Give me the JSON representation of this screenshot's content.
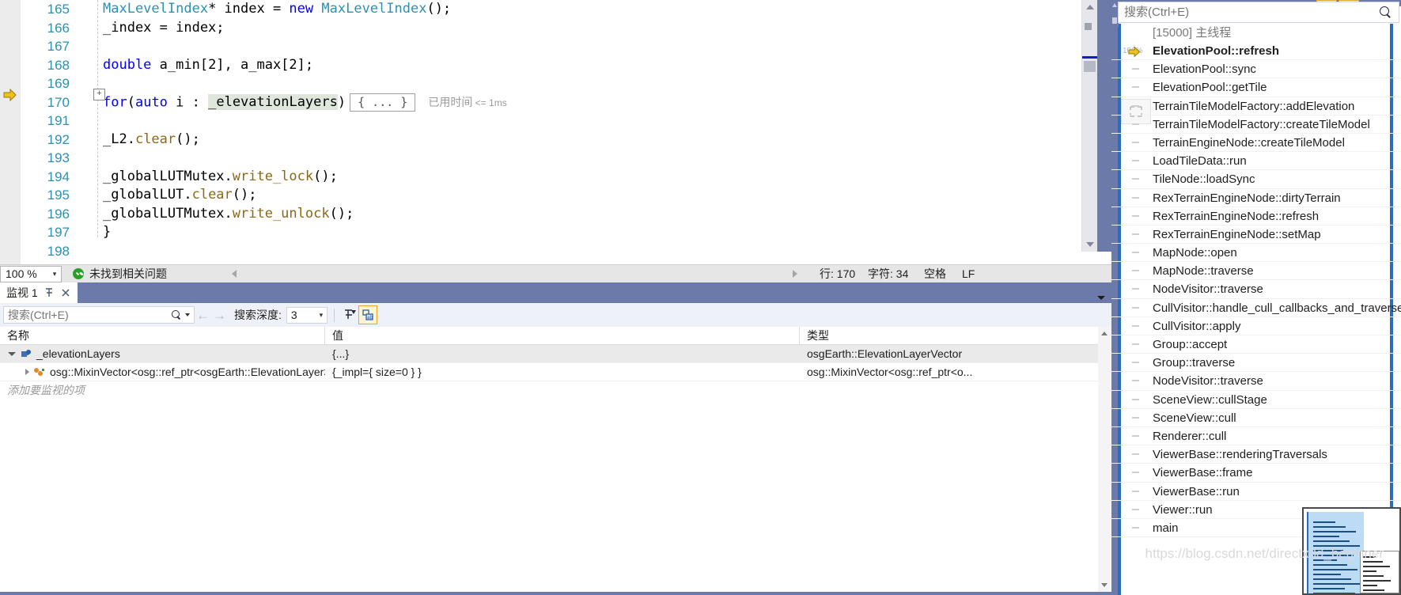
{
  "editor": {
    "lines": [
      {
        "num": "165",
        "segments": [
          {
            "t": "MaxLevelIndex",
            "c": "ty"
          },
          {
            "t": "* index = ",
            "c": "pl"
          },
          {
            "t": "new",
            "c": "kw"
          },
          {
            "t": " ",
            "c": "pl"
          },
          {
            "t": "MaxLevelIndex",
            "c": "ty"
          },
          {
            "t": "();",
            "c": "pl"
          }
        ]
      },
      {
        "num": "166",
        "segments": [
          {
            "t": "_index = index;",
            "c": "pl"
          }
        ]
      },
      {
        "num": "167",
        "segments": []
      },
      {
        "num": "168",
        "segments": [
          {
            "t": "double",
            "c": "kw"
          },
          {
            "t": " a_min[2], a_max[2];",
            "c": "pl"
          }
        ]
      },
      {
        "num": "169",
        "segments": []
      },
      {
        "num": "170",
        "segments": [
          {
            "t": "for",
            "c": "kw"
          },
          {
            "t": "(",
            "c": "pl"
          },
          {
            "t": "auto",
            "c": "kw"
          },
          {
            "t": " i : ",
            "c": "pl"
          },
          {
            "t": "_elevationLayers",
            "c": "hl-ident"
          },
          {
            "t": ")",
            "c": "pl"
          }
        ]
      },
      {
        "num": "191",
        "segments": []
      },
      {
        "num": "192",
        "segments": [
          {
            "t": "_L2.",
            "c": "pl"
          },
          {
            "t": "clear",
            "c": "fn"
          },
          {
            "t": "();",
            "c": "pl"
          }
        ]
      },
      {
        "num": "193",
        "segments": []
      },
      {
        "num": "194",
        "segments": [
          {
            "t": "_globalLUTMutex.",
            "c": "pl"
          },
          {
            "t": "write_lock",
            "c": "fn"
          },
          {
            "t": "();",
            "c": "pl"
          }
        ]
      },
      {
        "num": "195",
        "segments": [
          {
            "t": "_globalLUT.",
            "c": "pl"
          },
          {
            "t": "clear",
            "c": "fn"
          },
          {
            "t": "();",
            "c": "pl"
          }
        ]
      },
      {
        "num": "196",
        "segments": [
          {
            "t": "_globalLUTMutex.",
            "c": "pl"
          },
          {
            "t": "write_unlock",
            "c": "fn"
          },
          {
            "t": "();",
            "c": "pl"
          }
        ]
      },
      {
        "num": "197",
        "segments": [
          {
            "t": "}",
            "c": "pl"
          }
        ]
      },
      {
        "num": "198",
        "segments": []
      }
    ],
    "collapsed_block_label": "{ ... }",
    "elapsed_label": "已用时间",
    "elapsed_value": "<= 1ms",
    "outline_toggle": "+"
  },
  "editor_status": {
    "zoom_value": "100 %",
    "zoom_caret": "▾",
    "problems_text": "未找到相关问题",
    "line_label": "行: 170",
    "char_label": "字符: 34",
    "space_label": "空格",
    "eol_label": "LF"
  },
  "watch": {
    "tab_title": "监视 1",
    "pin_icon": "pin-icon",
    "close_icon": "close-icon",
    "search_placeholder": "搜索(Ctrl+E)",
    "search_value": "",
    "depth_label": "搜索深度:",
    "depth_value": "3",
    "back_arrow": "←",
    "forward_arrow": "→",
    "filter_icon": "filter-pin-icon",
    "hex_icon": "hex-display-icon",
    "columns": [
      "名称",
      "值",
      "类型"
    ],
    "rows": [
      {
        "name": "_elevationLayers",
        "value": "{...}",
        "type": "osgEarth::ElevationLayerVector",
        "depth": 0,
        "expanded": true,
        "selected": true,
        "icon": "field-icon"
      },
      {
        "name": "osg::MixinVector<osg::ref_ptr<osgEarth::ElevationLayer> ...",
        "value": "{_impl={ size=0 } }",
        "type": "osg::MixinVector<osg::ref_ptr<o...",
        "depth": 1,
        "expanded": false,
        "selected": false,
        "icon": "base-class-icon"
      }
    ],
    "add_watch_placeholder": "添加要监视的项"
  },
  "callstack": {
    "search_placeholder": "搜索(Ctrl+E)",
    "partial_top_text": "[15000] 主线程",
    "zoom_hint": "100%",
    "frames": [
      {
        "label": "ElevationPool::refresh",
        "current": true
      },
      {
        "label": "ElevationPool::sync",
        "current": false
      },
      {
        "label": "ElevationPool::getTile",
        "current": false
      },
      {
        "label": "TerrainTileModelFactory::addElevation",
        "current": false
      },
      {
        "label": "TerrainTileModelFactory::createTileModel",
        "current": false
      },
      {
        "label": "TerrainEngineNode::createTileModel",
        "current": false
      },
      {
        "label": "LoadTileData::run",
        "current": false
      },
      {
        "label": "TileNode::loadSync",
        "current": false
      },
      {
        "label": "RexTerrainEngineNode::dirtyTerrain",
        "current": false
      },
      {
        "label": "RexTerrainEngineNode::refresh",
        "current": false
      },
      {
        "label": "RexTerrainEngineNode::setMap",
        "current": false
      },
      {
        "label": "MapNode::open",
        "current": false
      },
      {
        "label": "MapNode::traverse",
        "current": false
      },
      {
        "label": "NodeVisitor::traverse",
        "current": false
      },
      {
        "label": "CullVisitor::handle_cull_callbacks_and_traverse",
        "current": false
      },
      {
        "label": "CullVisitor::apply",
        "current": false
      },
      {
        "label": "Group::accept",
        "current": false
      },
      {
        "label": "Group::traverse",
        "current": false
      },
      {
        "label": "NodeVisitor::traverse",
        "current": false
      },
      {
        "label": "SceneView::cullStage",
        "current": false
      },
      {
        "label": "SceneView::cull",
        "current": false
      },
      {
        "label": "Renderer::cull",
        "current": false
      },
      {
        "label": "ViewerBase::renderingTraversals",
        "current": false
      },
      {
        "label": "ViewerBase::frame",
        "current": false
      },
      {
        "label": "ViewerBase::run",
        "current": false
      },
      {
        "label": "Viewer::run",
        "current": false
      },
      {
        "label": "main",
        "current": false
      }
    ]
  },
  "watermark": "https://blog.csdn.net/directx3d_beginner",
  "colors": {
    "accent_blue": "#2a6ebb",
    "chrome_blue": "#6b7aa8",
    "line_number": "#2b91af",
    "keyword": "#0000ff",
    "type": "#2b91af",
    "function": "#8b6914",
    "highlight": "#dfe6dc"
  }
}
